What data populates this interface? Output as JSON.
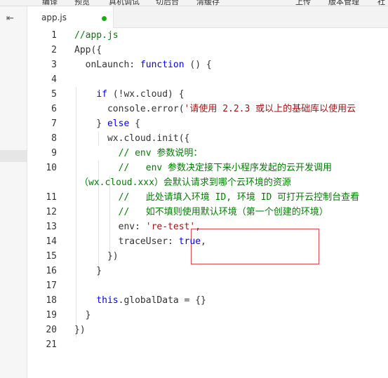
{
  "toolbar": {
    "items": [
      "编译",
      "预览",
      "真机调试",
      "切后台",
      "清缓存",
      "上传",
      "版本管理",
      "社"
    ]
  },
  "tab": {
    "filename": "app.js",
    "modified_color": "#1aad19"
  },
  "editor": {
    "lines": [
      {
        "n": "1",
        "parts": [
          {
            "c": "com",
            "t": "//app.js"
          }
        ]
      },
      {
        "n": "2",
        "parts": [
          {
            "c": "plain",
            "t": "App({"
          }
        ]
      },
      {
        "n": "3",
        "parts": [
          {
            "c": "plain",
            "t": "  onLaunch: "
          },
          {
            "c": "kw",
            "t": "function"
          },
          {
            "c": "plain",
            "t": " () {"
          }
        ]
      },
      {
        "n": "4",
        "parts": []
      },
      {
        "n": "5",
        "parts": [
          {
            "c": "plain",
            "t": "    "
          },
          {
            "c": "kw",
            "t": "if"
          },
          {
            "c": "plain",
            "t": " (!wx.cloud) {"
          }
        ]
      },
      {
        "n": "6",
        "parts": [
          {
            "c": "plain",
            "t": "      console.error("
          },
          {
            "c": "str",
            "t": "'请使用 2.2.3 或以上的基础库以使用云"
          }
        ]
      },
      {
        "n": "7",
        "parts": [
          {
            "c": "plain",
            "t": "    } "
          },
          {
            "c": "kw",
            "t": "else"
          },
          {
            "c": "plain",
            "t": " {"
          }
        ]
      },
      {
        "n": "8",
        "parts": [
          {
            "c": "plain",
            "t": "      wx.cloud.init({"
          }
        ]
      },
      {
        "n": "9",
        "parts": [
          {
            "c": "com",
            "t": "        // env 参数说明："
          }
        ]
      },
      {
        "n": "10",
        "parts": [
          {
            "c": "com",
            "t": "        //   env 参数决定接下来小程序发起的云开发调用"
          }
        ]
      },
      {
        "n": "11",
        "parts": [
          {
            "c": "com",
            "t": "        //   此处请填入环境 ID, 环境 ID 可打开云控制台查看"
          }
        ]
      },
      {
        "n": "12",
        "parts": [
          {
            "c": "com",
            "t": "        //   如不填则使用默认环境（第一个创建的环境）"
          }
        ]
      },
      {
        "n": "13",
        "parts": [
          {
            "c": "plain",
            "t": "        env: "
          },
          {
            "c": "str",
            "t": "'re-test'"
          },
          {
            "c": "plain",
            "t": ","
          }
        ]
      },
      {
        "n": "14",
        "parts": [
          {
            "c": "plain",
            "t": "        traceUser: "
          },
          {
            "c": "kw",
            "t": "true"
          },
          {
            "c": "plain",
            "t": ","
          }
        ]
      },
      {
        "n": "15",
        "parts": [
          {
            "c": "plain",
            "t": "      })"
          }
        ]
      },
      {
        "n": "16",
        "parts": [
          {
            "c": "plain",
            "t": "    }"
          }
        ]
      },
      {
        "n": "17",
        "parts": []
      },
      {
        "n": "18",
        "parts": [
          {
            "c": "plain",
            "t": "    "
          },
          {
            "c": "kw",
            "t": "this"
          },
          {
            "c": "plain",
            "t": ".globalData = {}"
          }
        ]
      },
      {
        "n": "19",
        "parts": [
          {
            "c": "plain",
            "t": "  }"
          }
        ]
      },
      {
        "n": "20",
        "parts": [
          {
            "c": "plain",
            "t": "})"
          }
        ]
      },
      {
        "n": "21",
        "parts": []
      }
    ],
    "wrapped_line_10": "（wx.cloud.xxx）会默认请求到哪个云环境的资源"
  }
}
